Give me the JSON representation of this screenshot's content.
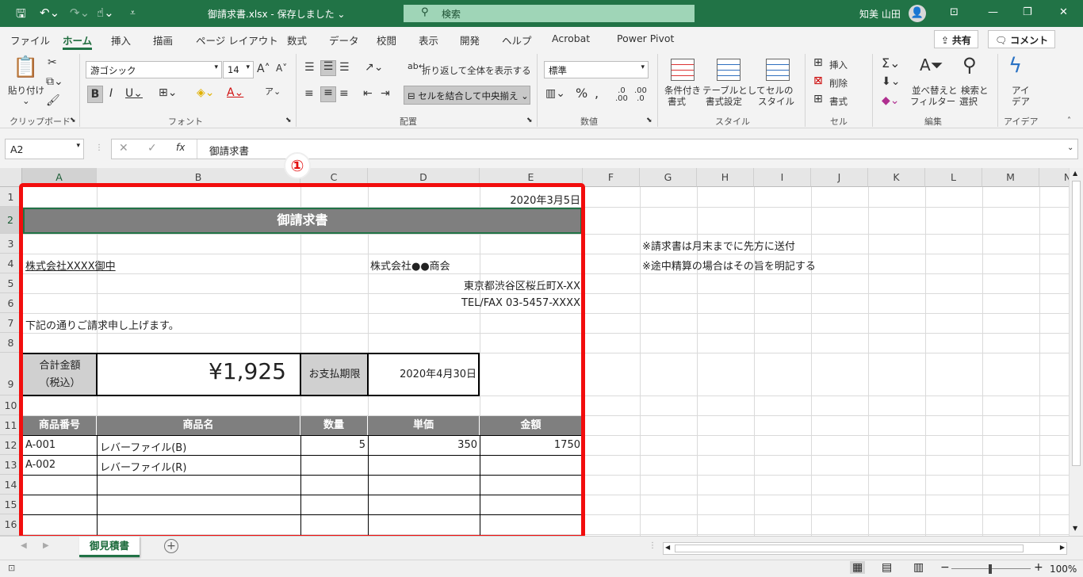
{
  "window": {
    "title": "御請求書.xlsx  -  保存しました  ⌄",
    "search_placeholder": "検索",
    "user": "知美 山田"
  },
  "tabs": [
    "ファイル",
    "ホーム",
    "挿入",
    "描画",
    "ページ レイアウト",
    "数式",
    "データ",
    "校閲",
    "表示",
    "開発",
    "ヘルプ",
    "Acrobat",
    "Power Pivot"
  ],
  "share_label": "共有",
  "comment_label": "コメント",
  "ribbon": {
    "paste_label_1": "貼り付け",
    "font_name": "游ゴシック",
    "font_size": "14",
    "wrap_text": "折り返して全体を表示する",
    "merge_center": "セルを結合して中央揃え",
    "number_format": "標準",
    "cond_format_1": "条件付き",
    "cond_format_2": "書式",
    "table_format_1": "テーブルとして",
    "table_format_2": "書式設定",
    "cell_style_1": "セルの",
    "cell_style_2": "スタイル",
    "insert": "挿入",
    "delete": "削除",
    "format": "書式",
    "sort_filter_1": "並べ替えと",
    "sort_filter_2": "フィルター",
    "find_select_1": "検索と",
    "find_select_2": "選択",
    "ideas_1": "アイ",
    "ideas_2": "デア",
    "groups": {
      "clipboard": "クリップボード",
      "font": "フォント",
      "alignment": "配置",
      "number": "数値",
      "styles": "スタイル",
      "cells": "セル",
      "editing": "編集",
      "ideas": "アイデア"
    }
  },
  "formula_bar": {
    "name_box": "A2",
    "formula": "御請求書",
    "fx": "fx"
  },
  "columns": [
    "A",
    "B",
    "C",
    "D",
    "E",
    "F",
    "G",
    "H",
    "I",
    "J",
    "K",
    "L",
    "M",
    "N"
  ],
  "rows": [
    "1",
    "2",
    "3",
    "4",
    "5",
    "6",
    "7",
    "8",
    "9",
    "10",
    "11",
    "12",
    "13",
    "14",
    "15",
    "16"
  ],
  "sheet": {
    "date": "2020年3月5日",
    "title": "御請求書",
    "recipient": "株式会社XXXX御中",
    "sender_company": "株式会社●●商会",
    "sender_address": "東京都渋谷区桜丘町X-XX",
    "sender_phone": "TEL/FAX 03-5457-XXXX",
    "intro": "下記の通りご請求申し上げます。",
    "total_label_1": "合計金額",
    "total_label_2": "（税込）",
    "total_value": "¥1,925",
    "due_label": "お支払期限",
    "due_date": "2020年4月30日",
    "table_headers": [
      "商品番号",
      "商品名",
      "数量",
      "単価",
      "金額"
    ],
    "items": [
      {
        "code": "A-001",
        "name": "レバーファイル(B)",
        "qty": "5",
        "price": "350",
        "amount": "1750"
      },
      {
        "code": "A-002",
        "name": "レバーファイル(R)",
        "qty": "",
        "price": "",
        "amount": ""
      }
    ],
    "note1": "※請求書は月末までに先方に送付",
    "note2": "※途中精算の場合はその旨を明記する"
  },
  "annotation_badge": "①",
  "sheet_tab": "御見積書",
  "status": {
    "zoom": "100%"
  }
}
